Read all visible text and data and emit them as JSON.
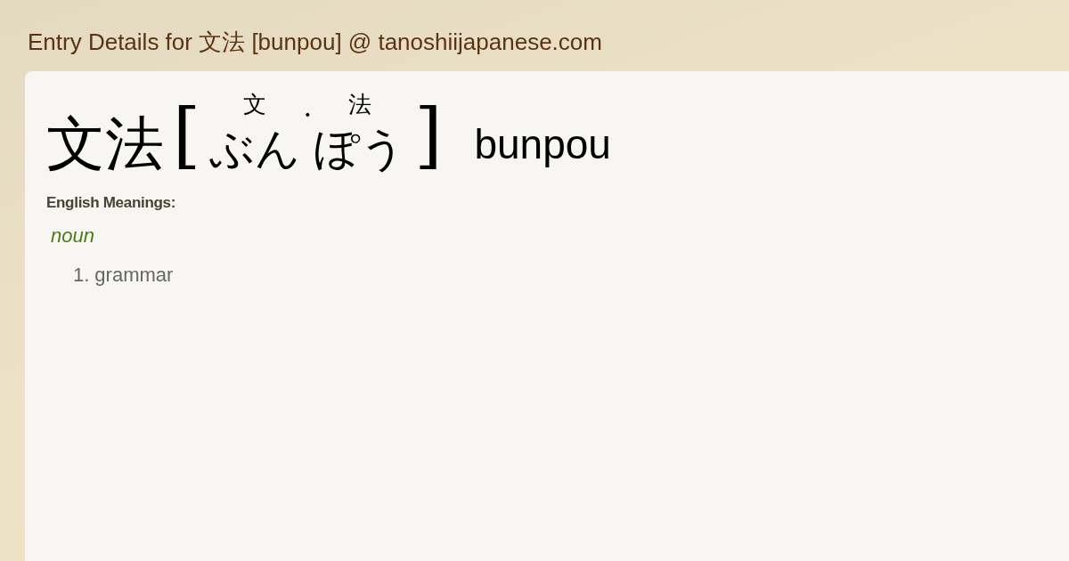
{
  "page_title": "Entry Details for 文法 [bunpou] @ tanoshiijapanese.com",
  "entry": {
    "word": "文法",
    "open_bracket": "[",
    "reading": [
      {
        "kind": "kanji",
        "ruby": "文",
        "kana": "ぶん"
      },
      {
        "kind": "dot",
        "ruby": "・"
      },
      {
        "kind": "kanji",
        "ruby": "法",
        "kana": "ぽう"
      }
    ],
    "close_bracket": "]",
    "romaji": "bunpou"
  },
  "meanings_heading": "English Meanings:",
  "part_of_speech": "noun",
  "meanings": [
    {
      "number": "1.",
      "text": "grammar"
    }
  ]
}
